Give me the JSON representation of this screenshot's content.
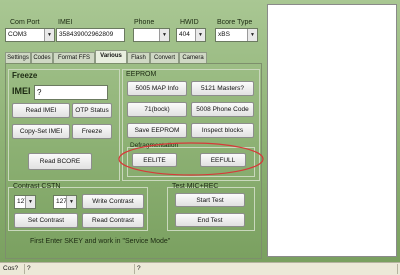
{
  "header": {
    "com_port": {
      "label": "Com Port",
      "value": "COM3"
    },
    "imei": {
      "label": "IMEI",
      "value": "358439002962809"
    },
    "phone": {
      "label": "Phone",
      "value": ""
    },
    "hwid": {
      "label": "HWID",
      "value": "404"
    },
    "bcore_type": {
      "label": "Bcore Type",
      "value": "xBS"
    }
  },
  "tabs": [
    {
      "label": "Settings"
    },
    {
      "label": "Codes"
    },
    {
      "label": "Format FFS"
    },
    {
      "label": "Various"
    },
    {
      "label": "Flash"
    },
    {
      "label": "Convert"
    },
    {
      "label": "Camera"
    }
  ],
  "active_tab": "Various",
  "freeze": {
    "title": "Freeze",
    "imei_label": "IMEI",
    "imei_value": "?",
    "read_imei": "Read IMEI",
    "otp_status": "OTP Status",
    "copy_set_imei": "Copy-Set IMEI",
    "freeze_button": "Freeze",
    "read_bcore": "Read BCORE"
  },
  "eeprom": {
    "title": "EEPROM",
    "btn_5005": "5005 MAP Info",
    "btn_5121": "5121 Masters?",
    "btn_71": "71(bock)",
    "btn_5008": "5008 Phone Code",
    "save_eeprom": "Save EEPROM",
    "inspect_blocks": "Inspect blocks"
  },
  "defrag": {
    "title": "Defragmentation",
    "eelite": "EELITE",
    "eefull": "EEFULL"
  },
  "contrast": {
    "title": "Contrast CSTN",
    "value1": "127",
    "value2": "127",
    "write_contrast": "Write Contrast",
    "set_contrast": "Set Contrast",
    "read_contrast": "Read Contrast"
  },
  "test_mic": {
    "title": "Test MIC+REC",
    "start_test": "Start Test",
    "end_test": "End Test"
  },
  "footer_note": "First Enter SKEY and work in \"Service Mode\"",
  "status_bar": {
    "cell1": "Cos?",
    "cell2": "?",
    "cell3": "?"
  },
  "colors": {
    "panel_top": "#a9c793",
    "panel_bottom": "#7aa060",
    "highlight_ellipse": "#d63a3a"
  }
}
